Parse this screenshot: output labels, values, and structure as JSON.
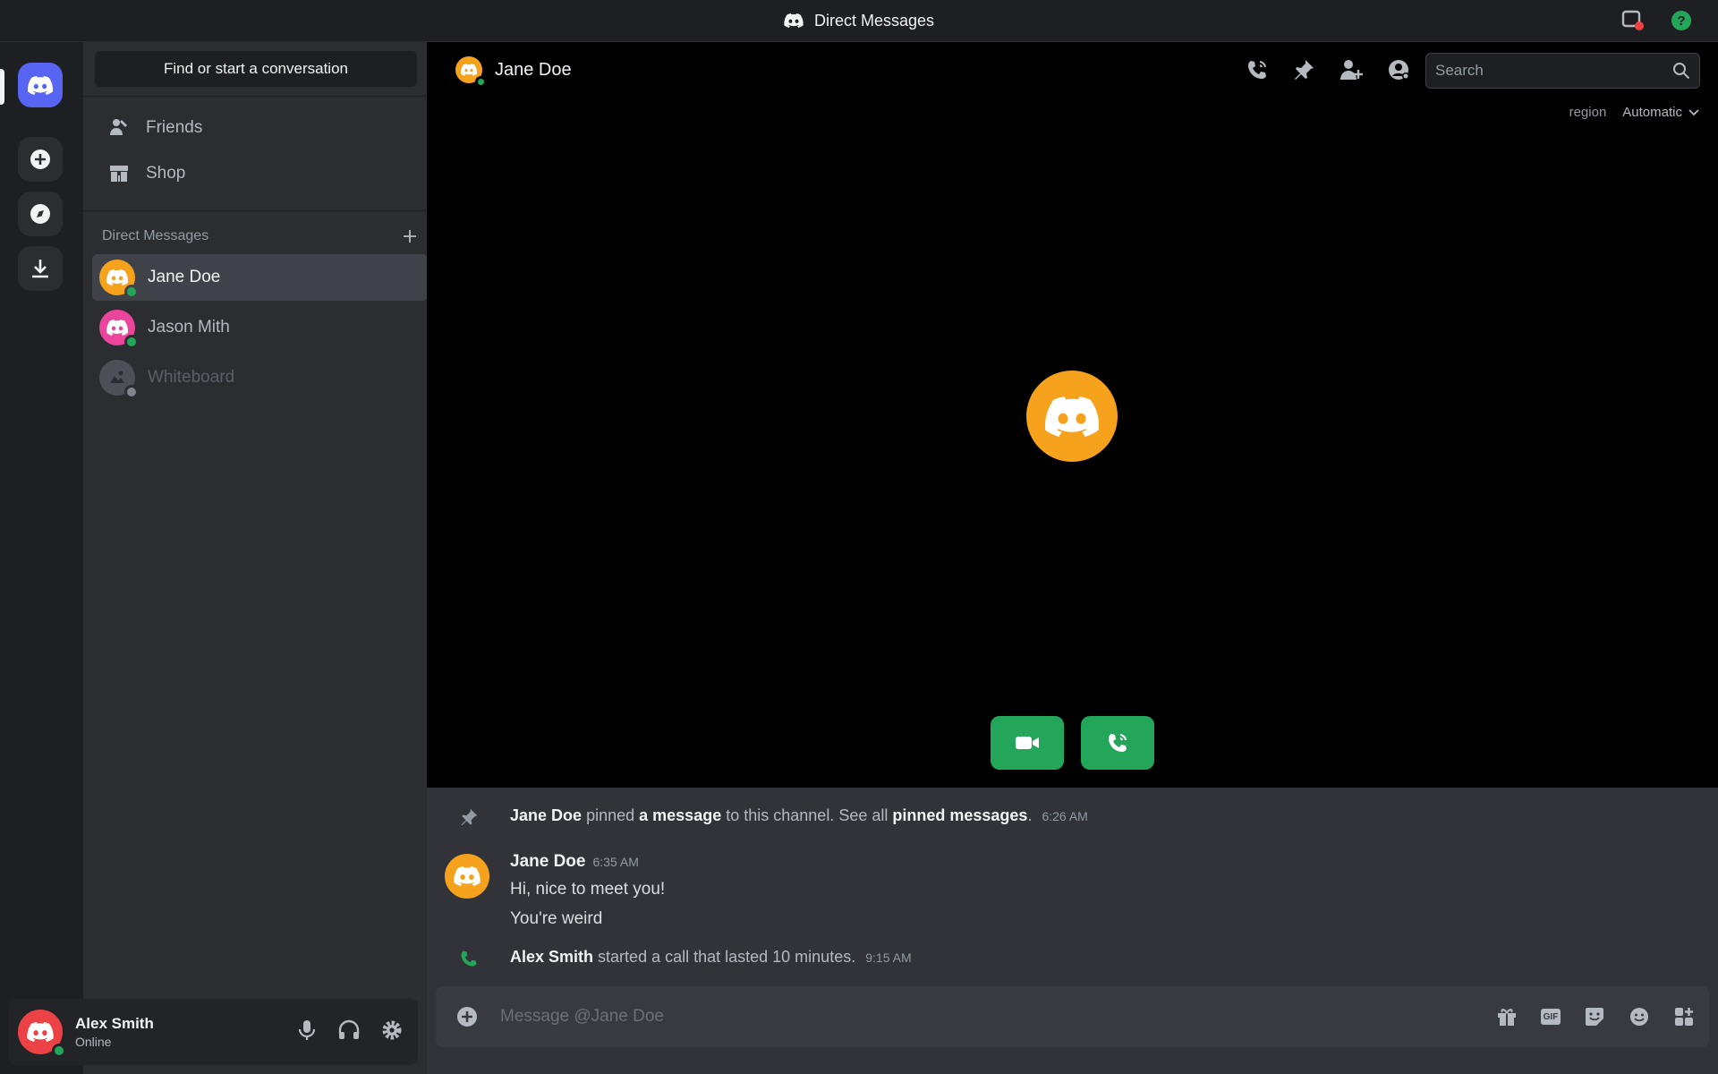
{
  "titlebar": {
    "title": "Direct Messages"
  },
  "sidebar": {
    "find_label": "Find or start a conversation",
    "nav": [
      {
        "label": "Friends",
        "icon": "friends-icon"
      },
      {
        "label": "Shop",
        "icon": "shop-icon"
      }
    ],
    "dm_header": "Direct Messages",
    "dms": [
      {
        "name": "Jane Doe",
        "color": "#f6a21c",
        "status": "online",
        "active": true
      },
      {
        "name": "Jason Mith",
        "color": "#eb459e",
        "status": "online",
        "active": false
      },
      {
        "name": "Whiteboard",
        "color": "#5c5f66",
        "status": "offline",
        "active": false
      }
    ]
  },
  "user": {
    "name": "Alex Smith",
    "status": "Online",
    "avatar_color": "#ed4245"
  },
  "channel": {
    "name": "Jane Doe",
    "search_placeholder": "Search",
    "region_label": "region",
    "region_value": "Automatic"
  },
  "messages": {
    "pin": {
      "author": "Jane Doe",
      "t1": "pinned",
      "link1": "a message",
      "t2": "to this channel. See all",
      "link2": "pinned messages",
      "t3": ".",
      "time": "6:26 AM"
    },
    "msg": {
      "author": "Jane Doe",
      "time": "6:35 AM",
      "lines": [
        "Hi, nice to meet you!",
        "You're weird"
      ]
    },
    "call": {
      "author": "Alex Smith",
      "text": "started a call that lasted 10 minutes.",
      "time": "9:15 AM"
    }
  },
  "composer": {
    "placeholder": "Message @Jane Doe"
  },
  "colors": {
    "accent": "#5865f2",
    "green": "#23a55a",
    "jane": "#f6a21c"
  }
}
